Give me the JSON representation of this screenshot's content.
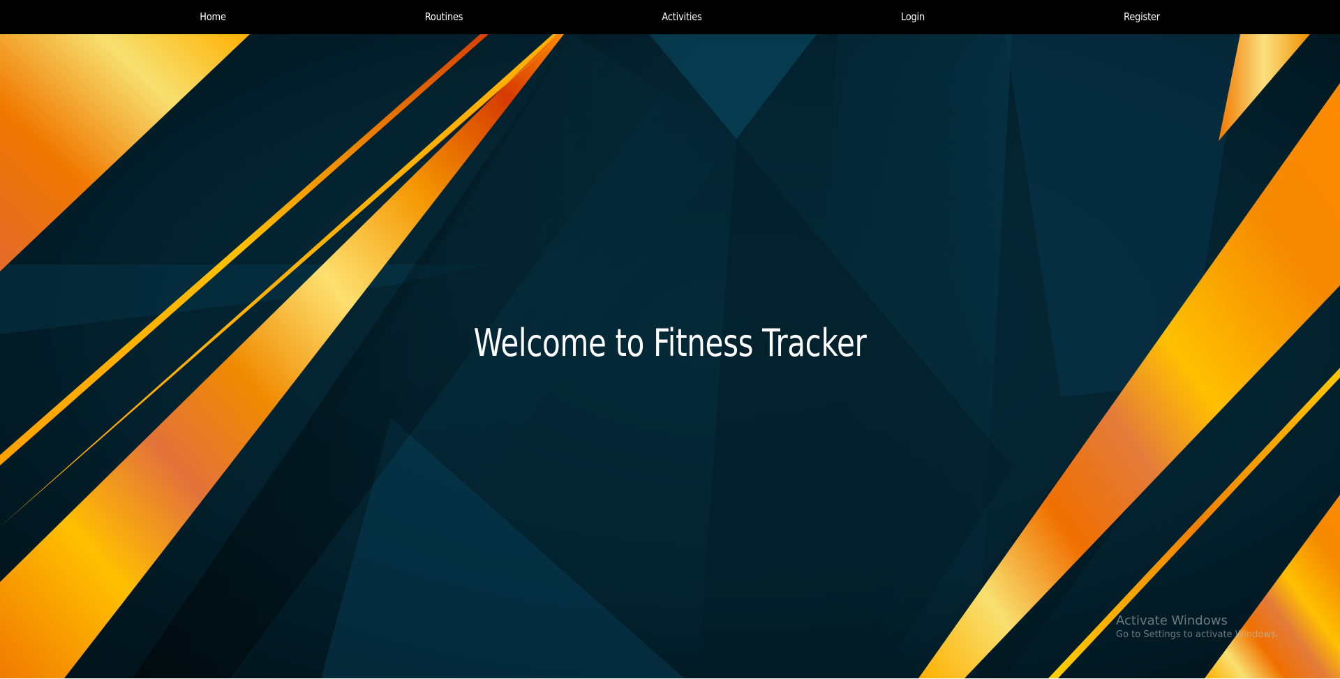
{
  "nav": {
    "items": [
      {
        "label": "Home"
      },
      {
        "label": "Routines"
      },
      {
        "label": "Activities"
      },
      {
        "label": "Login"
      },
      {
        "label": "Register"
      }
    ]
  },
  "hero": {
    "title": "Welcome to Fitness Tracker"
  },
  "watermark": {
    "title": "Activate Windows",
    "subtitle": "Go to Settings to activate Windows."
  },
  "colors": {
    "navbar_background": "#000000",
    "nav_text": "#ffffff",
    "hero_background": "#022433",
    "accent_orange": "#f08a00",
    "accent_gold": "#ffc400"
  }
}
